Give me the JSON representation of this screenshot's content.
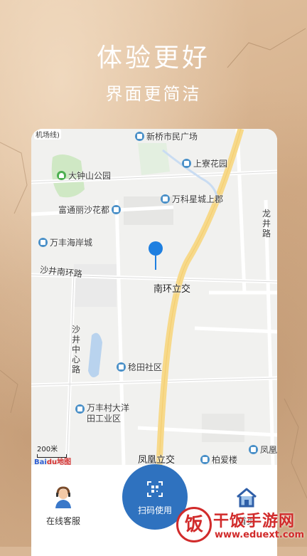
{
  "hero": {
    "title": "体验更好",
    "subtitle": "界面更简洁"
  },
  "map": {
    "labels": {
      "metro_line": "机场线)",
      "xinqiao": "新桥市民广场",
      "shangliao": "上寮花园",
      "dazhongshan": "大钟山公园",
      "wanke": "万科星城上郡",
      "futong": "富通丽沙花都",
      "longjing_road": "龙井路",
      "wanfeng_haian": "万丰海岸城",
      "shajing_nanhuan": "沙井南环路",
      "nanhuan_interchange": "南环立交",
      "shajing_zhongxin": "沙井中心路",
      "kuntian": "稔田社区",
      "wanfeng_dayang": "万丰村大洋\n田工业区",
      "fenghuang_interchange": "凤凰立交",
      "baiailou": "柏爱楼",
      "fenghuang_edge": "凤凰"
    },
    "scale_label": "200米",
    "attribution": {
      "part1": "Bai",
      "part2": "du地图"
    }
  },
  "bottom_nav": {
    "service_label": "在线客服",
    "scan_label": "扫码使用",
    "home_label": "首页"
  },
  "watermark": {
    "logo": "饭",
    "name": "干饭手游网",
    "url": "www.eduext.com"
  },
  "colors": {
    "accent": "#2f72bf",
    "pin": "#1e7fe0",
    "watermark": "#d12b2b"
  }
}
